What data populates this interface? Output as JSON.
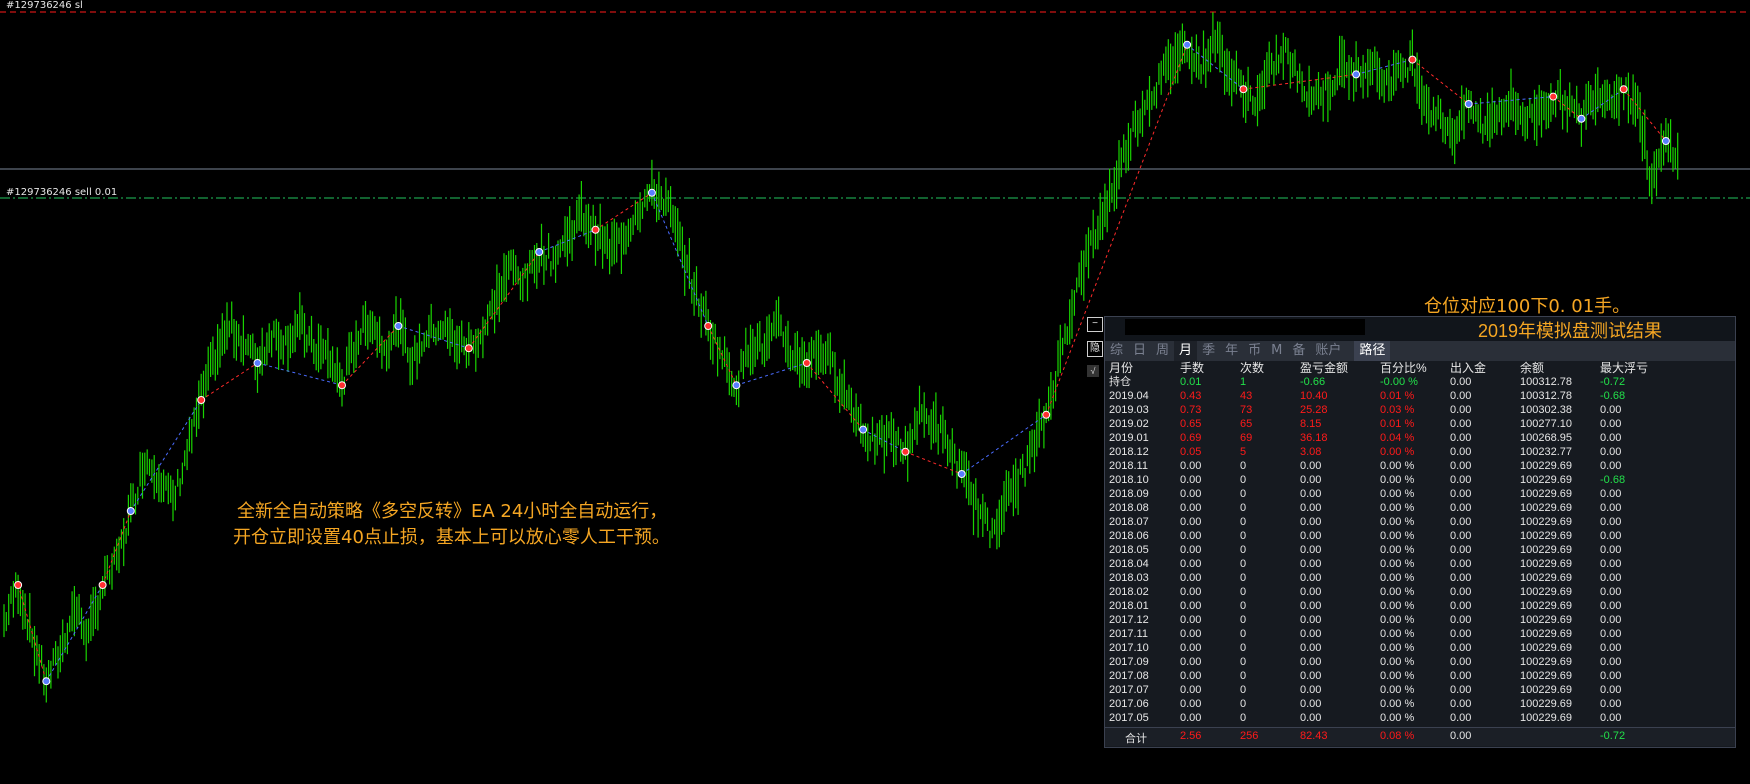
{
  "chart": {
    "sl_label": "#129736246 sl",
    "sell_label": "#129736246 sell 0.01",
    "colors": {
      "candle": "#19d400",
      "sl_line": "#ff1a1a",
      "open_line": "#22c55e",
      "price_line": "#7a8699",
      "accent": "#f5a623"
    }
  },
  "overlay": {
    "line1": "全新全自动策略《多空反转》EA 24小时全自动运行，",
    "line2": "开仓立即设置40点止损，基本上可以放心零人工干预。",
    "note": "仓位对应100下0. 01手。"
  },
  "panel": {
    "subtitle": "2019年模拟盘测试结果",
    "minimize_icon": "minus-icon",
    "hide_icon": "hide-icon",
    "check_icon": "check-icon",
    "minimize_glyph": "−",
    "hide_glyph": "隐",
    "check_glyph": "√",
    "tabs": [
      "综",
      "日",
      "周",
      "月",
      "季",
      "年",
      "币",
      "M",
      "备",
      "账户"
    ],
    "active_tab": "月",
    "path_tab": "路径",
    "headers": [
      "月份",
      "手数",
      "次数",
      "盈亏金额",
      "百分比%",
      "出入金",
      "余额",
      "最大浮亏"
    ],
    "rows": [
      {
        "month": "持仓",
        "lots": "0.01",
        "count": "1",
        "pnl": "-0.66",
        "pct": "-0.00 %",
        "flow": "0.00",
        "balance": "100312.78",
        "dd": "-0.72",
        "tone": "green",
        "dd_tone": "green"
      },
      {
        "month": "2019.04",
        "lots": "0.43",
        "count": "43",
        "pnl": "10.40",
        "pct": "0.01 %",
        "flow": "0.00",
        "balance": "100312.78",
        "dd": "-0.68",
        "tone": "red",
        "dd_tone": "green"
      },
      {
        "month": "2019.03",
        "lots": "0.73",
        "count": "73",
        "pnl": "25.28",
        "pct": "0.03 %",
        "flow": "0.00",
        "balance": "100302.38",
        "dd": "0.00",
        "tone": "red",
        "dd_tone": ""
      },
      {
        "month": "2019.02",
        "lots": "0.65",
        "count": "65",
        "pnl": "8.15",
        "pct": "0.01 %",
        "flow": "0.00",
        "balance": "100277.10",
        "dd": "0.00",
        "tone": "red",
        "dd_tone": ""
      },
      {
        "month": "2019.01",
        "lots": "0.69",
        "count": "69",
        "pnl": "36.18",
        "pct": "0.04 %",
        "flow": "0.00",
        "balance": "100268.95",
        "dd": "0.00",
        "tone": "red",
        "dd_tone": ""
      },
      {
        "month": "2018.12",
        "lots": "0.05",
        "count": "5",
        "pnl": "3.08",
        "pct": "0.00 %",
        "flow": "0.00",
        "balance": "100232.77",
        "dd": "0.00",
        "tone": "red",
        "dd_tone": ""
      },
      {
        "month": "2018.11",
        "lots": "0.00",
        "count": "0",
        "pnl": "0.00",
        "pct": "0.00 %",
        "flow": "0.00",
        "balance": "100229.69",
        "dd": "0.00",
        "tone": "",
        "dd_tone": ""
      },
      {
        "month": "2018.10",
        "lots": "0.00",
        "count": "0",
        "pnl": "0.00",
        "pct": "0.00 %",
        "flow": "0.00",
        "balance": "100229.69",
        "dd": "-0.68",
        "tone": "",
        "dd_tone": "green"
      },
      {
        "month": "2018.09",
        "lots": "0.00",
        "count": "0",
        "pnl": "0.00",
        "pct": "0.00 %",
        "flow": "0.00",
        "balance": "100229.69",
        "dd": "0.00",
        "tone": "",
        "dd_tone": ""
      },
      {
        "month": "2018.08",
        "lots": "0.00",
        "count": "0",
        "pnl": "0.00",
        "pct": "0.00 %",
        "flow": "0.00",
        "balance": "100229.69",
        "dd": "0.00",
        "tone": "",
        "dd_tone": ""
      },
      {
        "month": "2018.07",
        "lots": "0.00",
        "count": "0",
        "pnl": "0.00",
        "pct": "0.00 %",
        "flow": "0.00",
        "balance": "100229.69",
        "dd": "0.00",
        "tone": "",
        "dd_tone": ""
      },
      {
        "month": "2018.06",
        "lots": "0.00",
        "count": "0",
        "pnl": "0.00",
        "pct": "0.00 %",
        "flow": "0.00",
        "balance": "100229.69",
        "dd": "0.00",
        "tone": "",
        "dd_tone": ""
      },
      {
        "month": "2018.05",
        "lots": "0.00",
        "count": "0",
        "pnl": "0.00",
        "pct": "0.00 %",
        "flow": "0.00",
        "balance": "100229.69",
        "dd": "0.00",
        "tone": "",
        "dd_tone": ""
      },
      {
        "month": "2018.04",
        "lots": "0.00",
        "count": "0",
        "pnl": "0.00",
        "pct": "0.00 %",
        "flow": "0.00",
        "balance": "100229.69",
        "dd": "0.00",
        "tone": "",
        "dd_tone": ""
      },
      {
        "month": "2018.03",
        "lots": "0.00",
        "count": "0",
        "pnl": "0.00",
        "pct": "0.00 %",
        "flow": "0.00",
        "balance": "100229.69",
        "dd": "0.00",
        "tone": "",
        "dd_tone": ""
      },
      {
        "month": "2018.02",
        "lots": "0.00",
        "count": "0",
        "pnl": "0.00",
        "pct": "0.00 %",
        "flow": "0.00",
        "balance": "100229.69",
        "dd": "0.00",
        "tone": "",
        "dd_tone": ""
      },
      {
        "month": "2018.01",
        "lots": "0.00",
        "count": "0",
        "pnl": "0.00",
        "pct": "0.00 %",
        "flow": "0.00",
        "balance": "100229.69",
        "dd": "0.00",
        "tone": "",
        "dd_tone": ""
      },
      {
        "month": "2017.12",
        "lots": "0.00",
        "count": "0",
        "pnl": "0.00",
        "pct": "0.00 %",
        "flow": "0.00",
        "balance": "100229.69",
        "dd": "0.00",
        "tone": "",
        "dd_tone": ""
      },
      {
        "month": "2017.11",
        "lots": "0.00",
        "count": "0",
        "pnl": "0.00",
        "pct": "0.00 %",
        "flow": "0.00",
        "balance": "100229.69",
        "dd": "0.00",
        "tone": "",
        "dd_tone": ""
      },
      {
        "month": "2017.10",
        "lots": "0.00",
        "count": "0",
        "pnl": "0.00",
        "pct": "0.00 %",
        "flow": "0.00",
        "balance": "100229.69",
        "dd": "0.00",
        "tone": "",
        "dd_tone": ""
      },
      {
        "month": "2017.09",
        "lots": "0.00",
        "count": "0",
        "pnl": "0.00",
        "pct": "0.00 %",
        "flow": "0.00",
        "balance": "100229.69",
        "dd": "0.00",
        "tone": "",
        "dd_tone": ""
      },
      {
        "month": "2017.08",
        "lots": "0.00",
        "count": "0",
        "pnl": "0.00",
        "pct": "0.00 %",
        "flow": "0.00",
        "balance": "100229.69",
        "dd": "0.00",
        "tone": "",
        "dd_tone": ""
      },
      {
        "month": "2017.07",
        "lots": "0.00",
        "count": "0",
        "pnl": "0.00",
        "pct": "0.00 %",
        "flow": "0.00",
        "balance": "100229.69",
        "dd": "0.00",
        "tone": "",
        "dd_tone": ""
      },
      {
        "month": "2017.06",
        "lots": "0.00",
        "count": "0",
        "pnl": "0.00",
        "pct": "0.00 %",
        "flow": "0.00",
        "balance": "100229.69",
        "dd": "0.00",
        "tone": "",
        "dd_tone": ""
      },
      {
        "month": "2017.05",
        "lots": "0.00",
        "count": "0",
        "pnl": "0.00",
        "pct": "0.00 %",
        "flow": "0.00",
        "balance": "100229.69",
        "dd": "0.00",
        "tone": "",
        "dd_tone": ""
      }
    ],
    "total": {
      "label": "合计",
      "lots": "2.56",
      "count": "256",
      "pnl": "82.43",
      "pct": "0.08 %",
      "flow": "0.00",
      "balance": "",
      "dd": "-0.72"
    }
  },
  "chart_data": {
    "type": "line",
    "title": "",
    "xlabel": "",
    "ylabel": "",
    "series": [
      {
        "values": [
          0.2,
          0.25,
          0.18,
          0.12,
          0.16,
          0.22,
          0.18,
          0.25,
          0.28,
          0.35,
          0.42,
          0.4,
          0.36,
          0.43,
          0.5,
          0.56,
          0.6,
          0.58,
          0.55,
          0.59,
          0.58,
          0.6,
          0.57,
          0.56,
          0.52,
          0.58,
          0.61,
          0.57,
          0.6,
          0.55,
          0.59,
          0.6,
          0.58,
          0.57,
          0.59,
          0.64,
          0.68,
          0.66,
          0.7,
          0.69,
          0.72,
          0.75,
          0.73,
          0.7,
          0.72,
          0.76,
          0.78,
          0.77,
          0.71,
          0.65,
          0.6,
          0.56,
          0.52,
          0.58,
          0.57,
          0.6,
          0.56,
          0.55,
          0.57,
          0.54,
          0.5,
          0.46,
          0.44,
          0.45,
          0.43,
          0.48,
          0.47,
          0.44,
          0.4,
          0.36,
          0.32,
          0.36,
          0.39,
          0.43,
          0.48,
          0.56,
          0.64,
          0.7,
          0.75,
          0.8,
          0.86,
          0.9,
          0.93,
          0.96,
          0.98,
          0.95,
          0.99,
          0.94,
          0.92,
          0.9,
          0.95,
          0.97,
          0.93,
          0.91,
          0.92,
          0.95,
          0.94,
          0.96,
          0.93,
          0.94,
          0.96,
          0.9,
          0.88,
          0.86,
          0.9,
          0.87,
          0.89,
          0.9,
          0.88,
          0.89,
          0.91,
          0.9,
          0.88,
          0.92,
          0.91,
          0.92,
          0.9,
          0.79,
          0.85,
          0.83
        ]
      }
    ],
    "reference_lines": [
      {
        "label": "#129736246 sl",
        "style": "dash-red"
      },
      {
        "label": "#129736246 sell 0.01",
        "style": "dashdot-green"
      }
    ],
    "grid": false,
    "legend": "none"
  }
}
